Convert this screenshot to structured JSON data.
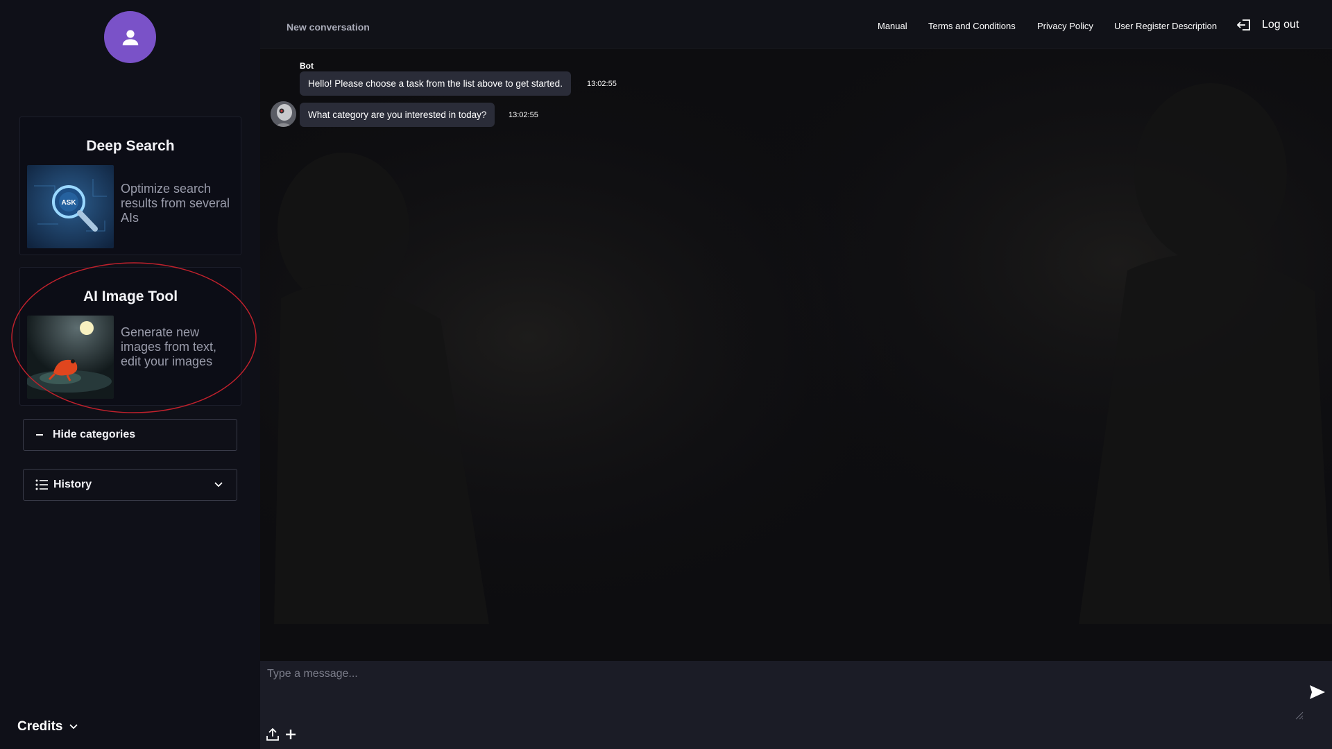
{
  "sidebar": {
    "avatar_icon": "user-icon",
    "cards": [
      {
        "title": "Deep Search",
        "description": "Optimize search results from several AIs",
        "thumb_text": "ASK"
      },
      {
        "title": "AI Image Tool",
        "description": "Generate new images from text, edit your images"
      }
    ],
    "hide_categories_label": "Hide categories",
    "history_label": "History",
    "credits_label": "Credits"
  },
  "header": {
    "conversation_title": "New conversation",
    "links": [
      "Manual",
      "Terms and Conditions",
      "Privacy Policy",
      "User Register Description"
    ],
    "logout_label": "Log out"
  },
  "chat": {
    "author": "Bot",
    "messages": [
      {
        "text": "Hello! Please choose a task from the list above to get started.",
        "time": "13:02:55"
      },
      {
        "text": "What category are you interested in today?",
        "time": "13:02:55"
      }
    ]
  },
  "composer": {
    "placeholder": "Type a message..."
  },
  "colors": {
    "accent": "#7a52c8",
    "highlight_annotation": "#c0212c"
  }
}
